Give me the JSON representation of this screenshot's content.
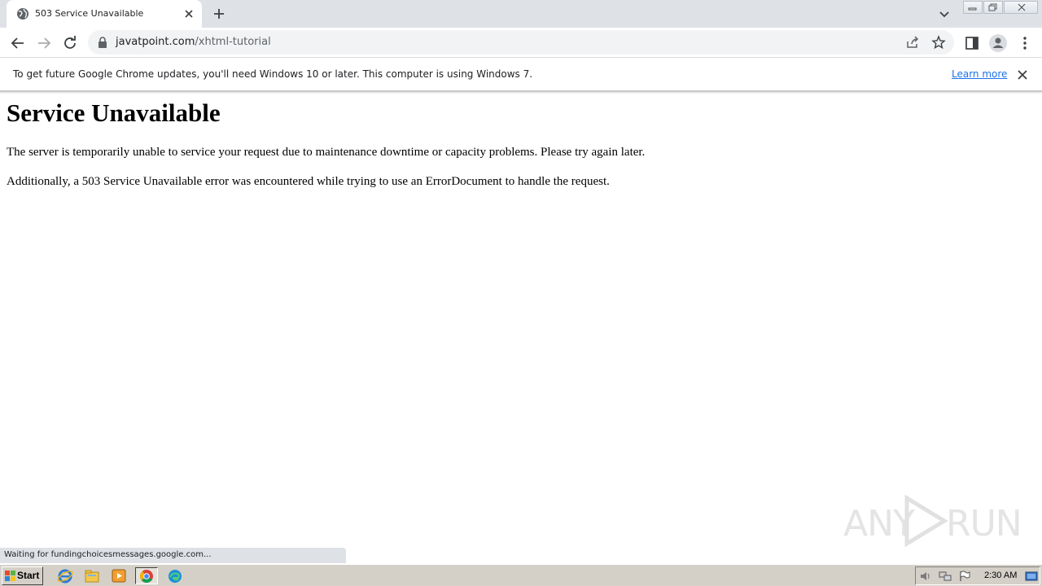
{
  "browser": {
    "tab": {
      "title": "503 Service Unavailable"
    },
    "address": {
      "domain": "javatpoint.com",
      "path": "/xhtml-tutorial"
    },
    "infobar": {
      "message": "To get future Google Chrome updates, you'll need Windows 10 or later. This computer is using Windows 7.",
      "link_label": "Learn more"
    },
    "status": "Waiting for fundingchoicesmessages.google.com..."
  },
  "page": {
    "heading": "Service Unavailable",
    "paragraphs": [
      "The server is temporarily unable to service your request due to maintenance downtime or capacity problems. Please try again later.",
      "Additionally, a 503 Service Unavailable error was encountered while trying to use an ErrorDocument to handle the request."
    ]
  },
  "watermark": {
    "left": "ANY",
    "right": "RUN"
  },
  "taskbar": {
    "start_label": "Start",
    "apps": [
      "ie-icon",
      "explorer-icon",
      "media-player-icon",
      "chrome-icon",
      "edge-icon"
    ],
    "clock": "2:30 AM"
  },
  "colors": {
    "tabstrip": "#dee1e6",
    "link": "#1a73e8",
    "taskbar": "#d4d0c8"
  }
}
